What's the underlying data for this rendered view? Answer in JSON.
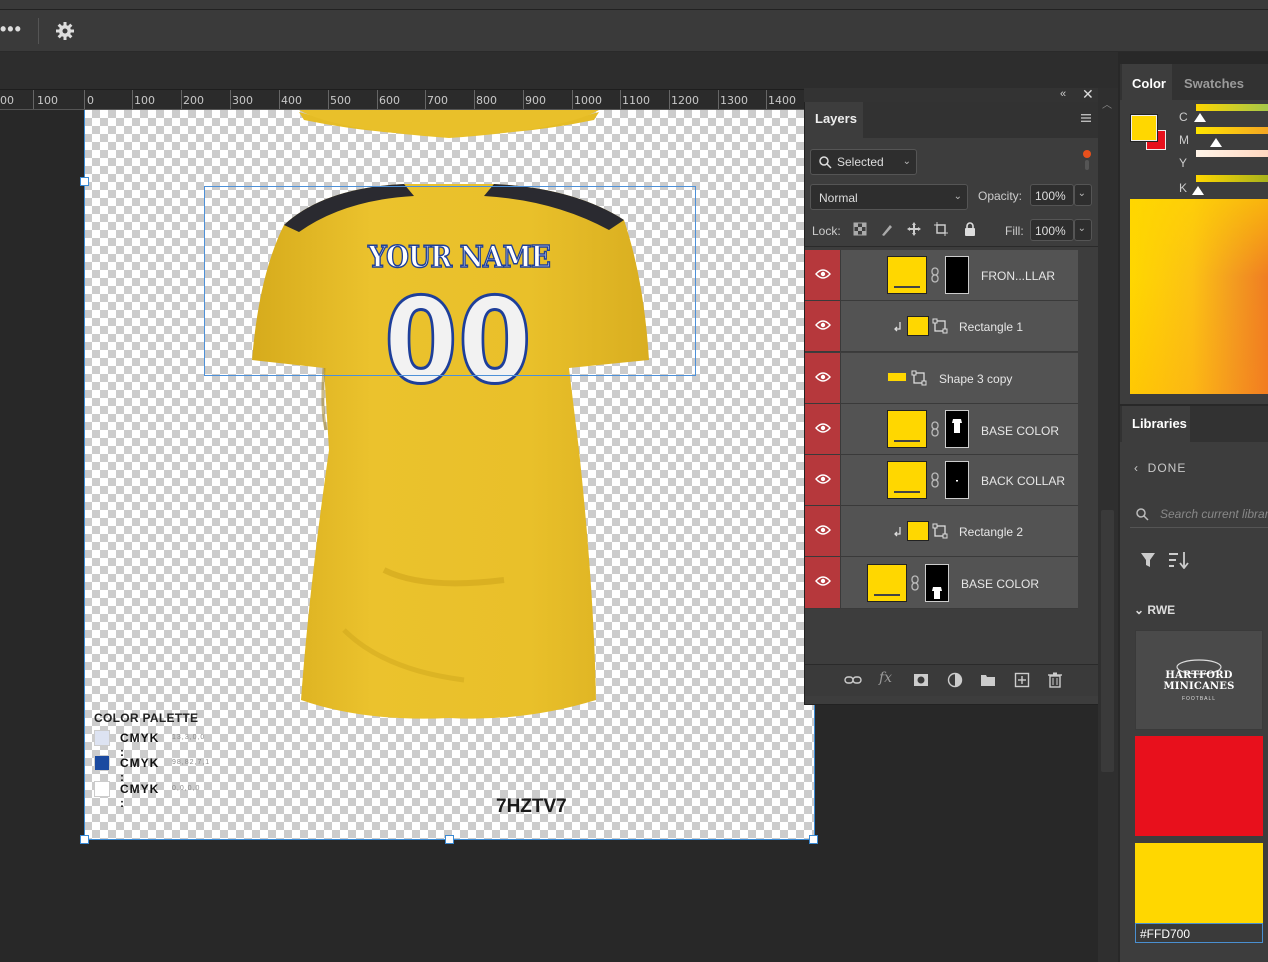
{
  "options_bar": {
    "more_icon": "more-dots-icon",
    "settings_icon": "gear-icon"
  },
  "ruler": {
    "labels": [
      "00",
      "100",
      "0",
      "100",
      "200",
      "300",
      "400",
      "500",
      "600",
      "700",
      "800",
      "900",
      "1000",
      "1100",
      "1200",
      "1300",
      "1400"
    ]
  },
  "canvas": {
    "jersey_name": "YOUR NAME",
    "jersey_number": "00",
    "palette_title": "COLOR PALETTE",
    "palette": [
      {
        "label": "CMYK :",
        "value": "13,3,0,0",
        "color": "#dde3f2"
      },
      {
        "label": "CMYK :",
        "value": "98,82,7,1",
        "color": "#1b4aa0"
      },
      {
        "label": "CMYK :",
        "value": "0,0,0,0",
        "color": "#ffffff"
      }
    ],
    "code": "7HZTV7",
    "shirt_color": "#e9c02a"
  },
  "layers": {
    "tab": "Layers",
    "filter": "Selected",
    "blend_mode": "Normal",
    "opacity_label": "Opacity:",
    "opacity": "100%",
    "lock_label": "Lock:",
    "fill_label": "Fill:",
    "fill": "100%",
    "rows": [
      {
        "name": "FRON...LLAR",
        "kind": "masked"
      },
      {
        "name": "Rectangle 1",
        "kind": "clipped-shape"
      },
      {
        "name": "Shape 3 copy",
        "kind": "shape"
      },
      {
        "name": "BASE COLOR",
        "kind": "masked"
      },
      {
        "name": "BACK COLLAR",
        "kind": "masked"
      },
      {
        "name": "Rectangle 2",
        "kind": "clipped-shape"
      },
      {
        "name": "BASE COLOR",
        "kind": "masked"
      }
    ],
    "bottom_icons": [
      "link-layers-icon",
      "fx-icon",
      "add-mask-icon",
      "adjustment-layer-icon",
      "new-group-icon",
      "new-layer-icon",
      "delete-layer-icon"
    ]
  },
  "color_panel": {
    "tabs": [
      "Color",
      "Swatches"
    ],
    "foreground": "#ffd700",
    "background": "#e8101c",
    "sliders": [
      {
        "letter": "C",
        "value": 0
      },
      {
        "letter": "M",
        "value": 23
      },
      {
        "letter": "Y",
        "value": 0
      },
      {
        "letter": "K",
        "value": 0
      }
    ]
  },
  "libraries": {
    "tab": "Libraries",
    "done": "DONE",
    "search_placeholder": "Search current library",
    "group": "RWE",
    "logo_text": "HARTFORD MINICANES",
    "logo_sub": "FOOTBALL",
    "assets": [
      {
        "type": "logo"
      },
      {
        "type": "color",
        "color": "#e8101c"
      },
      {
        "type": "color",
        "color": "#ffd700",
        "label": "#FFD700"
      }
    ]
  }
}
